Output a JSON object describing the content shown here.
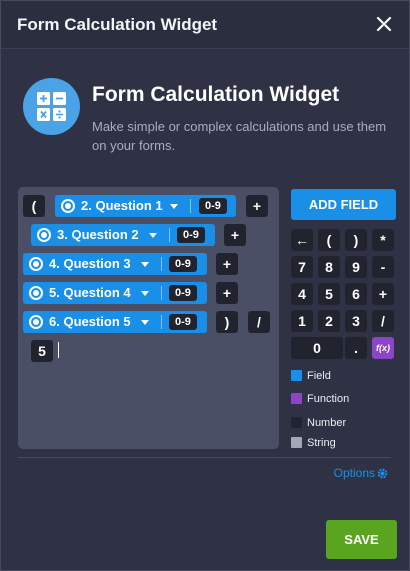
{
  "header": {
    "title": "Form Calculation Widget",
    "close_icon": "close-icon"
  },
  "intro": {
    "icon": "calculator-icon",
    "title": "Form Calculation Widget",
    "description": "Make simple or complex calculations and use them on your forms."
  },
  "formula": {
    "row1": {
      "open_paren": "(",
      "field": "2. Question 1",
      "range": "0-9",
      "operator": "+"
    },
    "row2": {
      "field": "3. Question 2",
      "range": "0-9",
      "operator": "+"
    },
    "row3": {
      "field": "4. Question 3",
      "range": "0-9",
      "operator": "+"
    },
    "row4": {
      "field": "5. Question 4",
      "range": "0-9",
      "operator": "+"
    },
    "row5": {
      "field": "6. Question 5",
      "range": "0-9",
      "close_paren": ")",
      "operator": "/"
    },
    "row6": {
      "number": "5"
    }
  },
  "add_field_label": "ADD FIELD",
  "keypad": {
    "back": "←",
    "open_paren": "(",
    "close_paren": ")",
    "multiply": "*",
    "k7": "7",
    "k8": "8",
    "k9": "9",
    "minus": "-",
    "k4": "4",
    "k5": "5",
    "k6": "6",
    "plus": "+",
    "k1": "1",
    "k2": "2",
    "k3": "3",
    "divide": "/",
    "k0": "0",
    "dot": ".",
    "function": "f(x)"
  },
  "legend": [
    {
      "label": "Field",
      "color": "#1a8fe8"
    },
    {
      "label": "Function",
      "color": "#8e44c8"
    },
    {
      "label": "Number",
      "color": "#21232f"
    },
    {
      "label": "String",
      "color": "#a3a8b8"
    }
  ],
  "options_label": "Options",
  "save_label": "SAVE"
}
